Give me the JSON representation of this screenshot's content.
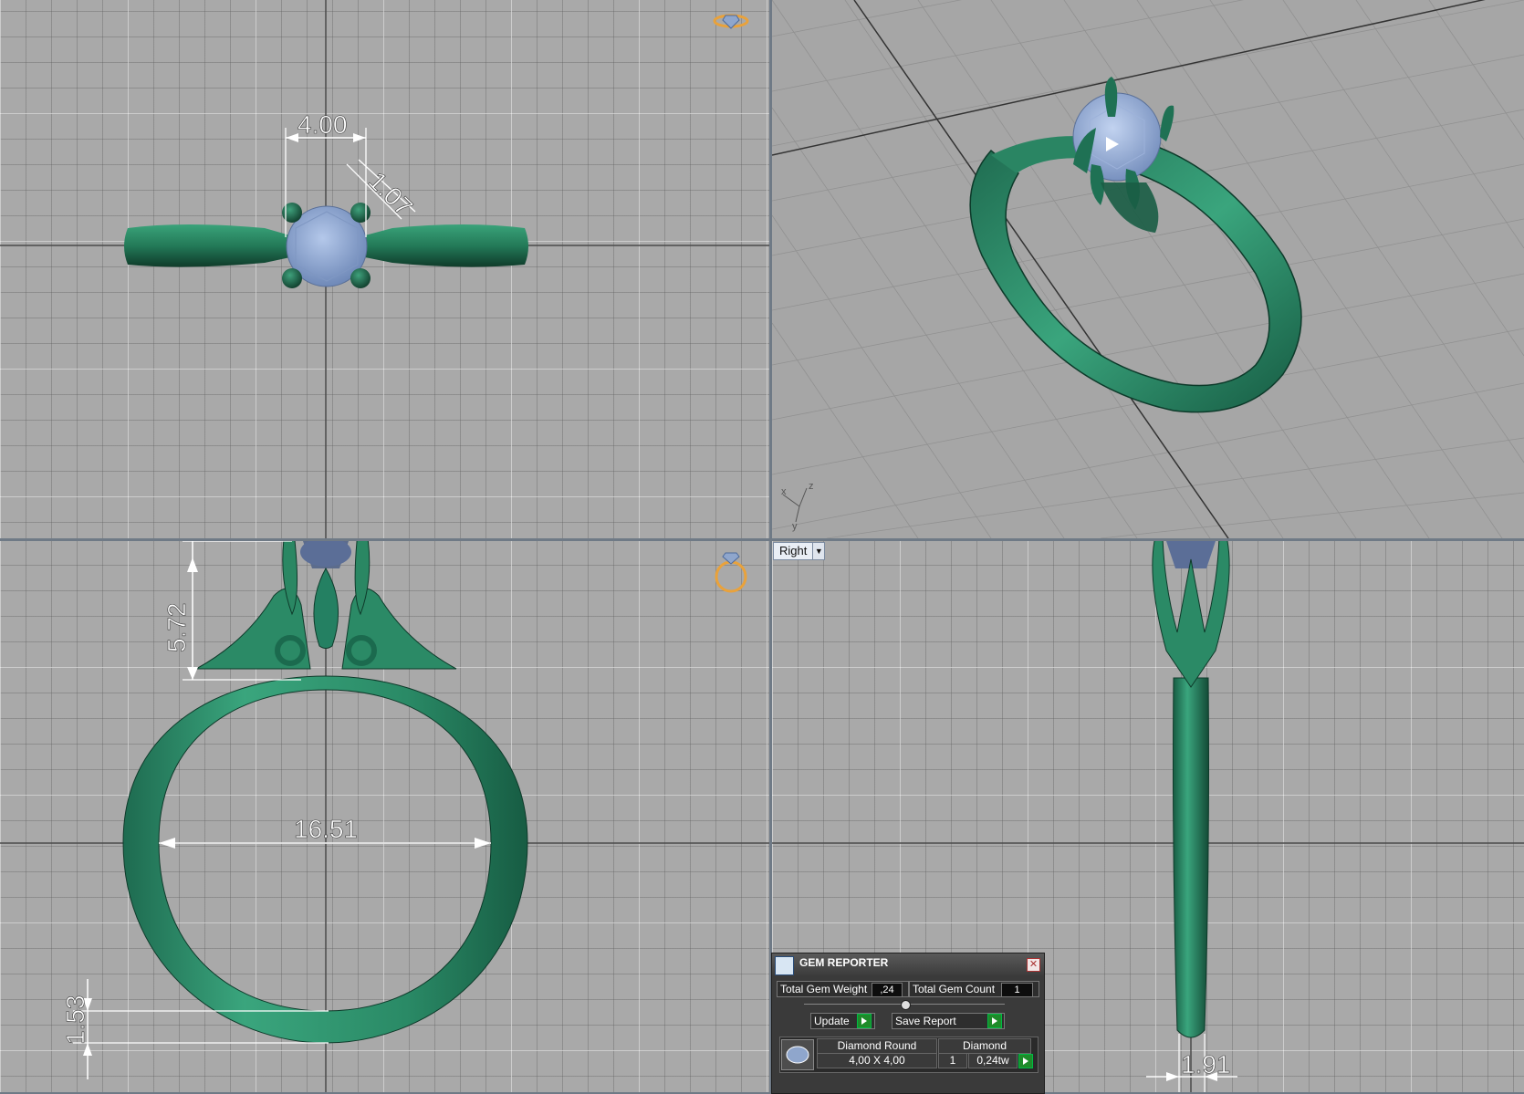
{
  "viewports": {
    "top": {
      "dims": {
        "width": "4.00",
        "prong": "1.07"
      }
    },
    "front": {
      "dims": {
        "height": "5.72",
        "inner_diameter": "16.51",
        "band": "1.53"
      }
    },
    "right": {
      "dims": {
        "width": "1.91"
      }
    },
    "perspective": {
      "axes": {
        "x": "x",
        "y": "y",
        "z": "z"
      }
    }
  },
  "view_selector": {
    "label": "Right"
  },
  "gem_reporter": {
    "title": "GEM REPORTER",
    "total_weight_label": "Total Gem Weight",
    "total_weight_value": ",24",
    "total_count_label": "Total Gem Count",
    "total_count_value": "1",
    "update_label": "Update",
    "save_report_label": "Save Report",
    "gem_row": {
      "shape": "Diamond Round",
      "size": "4,00 X 4,00",
      "material": "Diamond",
      "count": "1",
      "weight": "0,24tw"
    }
  },
  "colors": {
    "metal": "#2f7f62",
    "gem": "#8fa6cc",
    "accent_orange": "#e9a23b"
  }
}
